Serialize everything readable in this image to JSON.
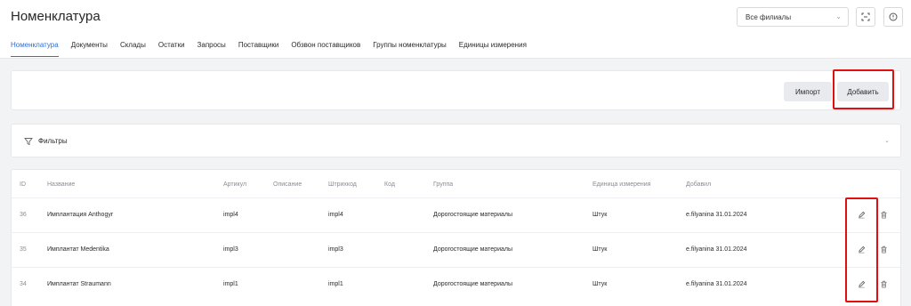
{
  "header": {
    "title": "Номенклатура",
    "branch_select": "Все филиалы",
    "fullscreen_icon": "fullscreen-icon",
    "info_icon": "info-icon"
  },
  "tabs": [
    {
      "label": "Номенклатура",
      "active": true
    },
    {
      "label": "Документы"
    },
    {
      "label": "Склады"
    },
    {
      "label": "Остатки"
    },
    {
      "label": "Запросы"
    },
    {
      "label": "Поставщики"
    },
    {
      "label": "Обзвон поставщиков"
    },
    {
      "label": "Группы номенклатуры"
    },
    {
      "label": "Единицы измерения"
    }
  ],
  "actions": {
    "import_label": "Импорт",
    "add_label": "Добавить"
  },
  "filters": {
    "label": "Фильтры"
  },
  "table": {
    "columns": [
      "ID",
      "Название",
      "Артикул",
      "Описание",
      "Штрихкод",
      "Код",
      "Группа",
      "Единица измерения",
      "Добавил"
    ],
    "rows": [
      {
        "id": "36",
        "name": "Имплантация Anthogyr",
        "article": "impl4",
        "description": "",
        "barcode": "impl4",
        "code": "",
        "group": "Дорогостоящие материалы",
        "unit": "Штук",
        "added_by": "e.filyanina 31.01.2024"
      },
      {
        "id": "35",
        "name": "Имплантат Medentika",
        "article": "impl3",
        "description": "",
        "barcode": "impl3",
        "code": "",
        "group": "Дорогостоящие материалы",
        "unit": "Штук",
        "added_by": "e.filyanina 31.01.2024"
      },
      {
        "id": "34",
        "name": "Имплантат Straumann",
        "article": "impl1",
        "description": "",
        "barcode": "impl1",
        "code": "",
        "group": "Дорогостоящие материалы",
        "unit": "Штук",
        "added_by": "e.filyanina 31.01.2024"
      }
    ]
  },
  "colors": {
    "accent": "#2f6fd6",
    "highlight": "#e01010"
  }
}
